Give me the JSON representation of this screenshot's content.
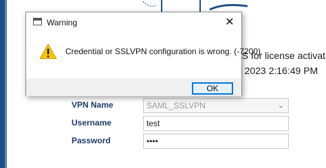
{
  "background": {
    "ems_text": "MS for license activation.",
    "date_text": "5, 2023 2:16:49 PM",
    "form": {
      "vpn_name_label": "VPN Name",
      "vpn_name_value": "SAML_SSLVPN",
      "username_label": "Username",
      "username_value": "test",
      "password_label": "Password",
      "password_value": "••••"
    }
  },
  "dialog": {
    "title": "Warning",
    "message": "Credential or SSLVPN configuration is wrong. (-7200)",
    "ok_label": "OK",
    "close_glyph": "✕",
    "icon": "warning-icon"
  },
  "colors": {
    "accent": "#0078d7",
    "warning": "#f5c400",
    "brand": "#1f4f8a"
  }
}
